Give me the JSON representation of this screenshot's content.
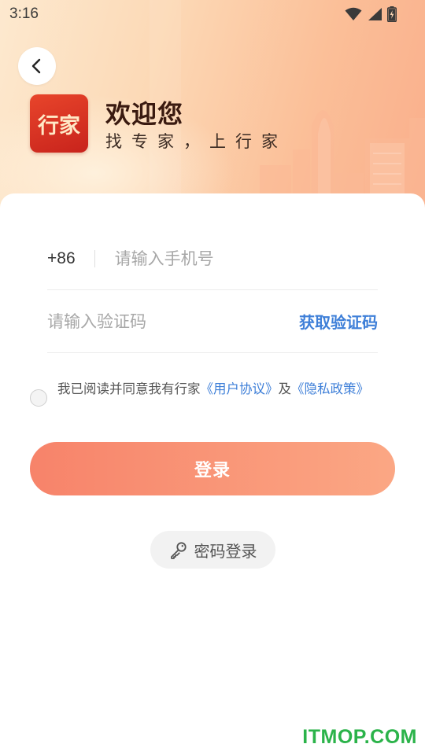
{
  "status_bar": {
    "time": "3:16",
    "icons": [
      "wifi-icon",
      "signal-icon",
      "battery-charging-icon"
    ]
  },
  "header": {
    "back_icon": "chevron-left-icon",
    "logo_text": "行家",
    "title": "欢迎您",
    "subtitle": "找专家，上行家"
  },
  "form": {
    "country_code": "+86",
    "phone_placeholder": "请输入手机号",
    "code_placeholder": "请输入验证码",
    "get_code_label": "获取验证码"
  },
  "agreement": {
    "prefix": "我已阅读并同意我有行家",
    "user_agreement": "《用户协议》",
    "conjunction": "及",
    "privacy_policy": "《隐私政策》",
    "checked": false
  },
  "login_button": "登录",
  "password_login": {
    "icon": "key-icon",
    "label": "密码登录"
  },
  "watermark": "ITMOP.COM",
  "colors": {
    "accent": "#f7836a",
    "link": "#3e7fd8",
    "logo_red": "#d4321f"
  }
}
